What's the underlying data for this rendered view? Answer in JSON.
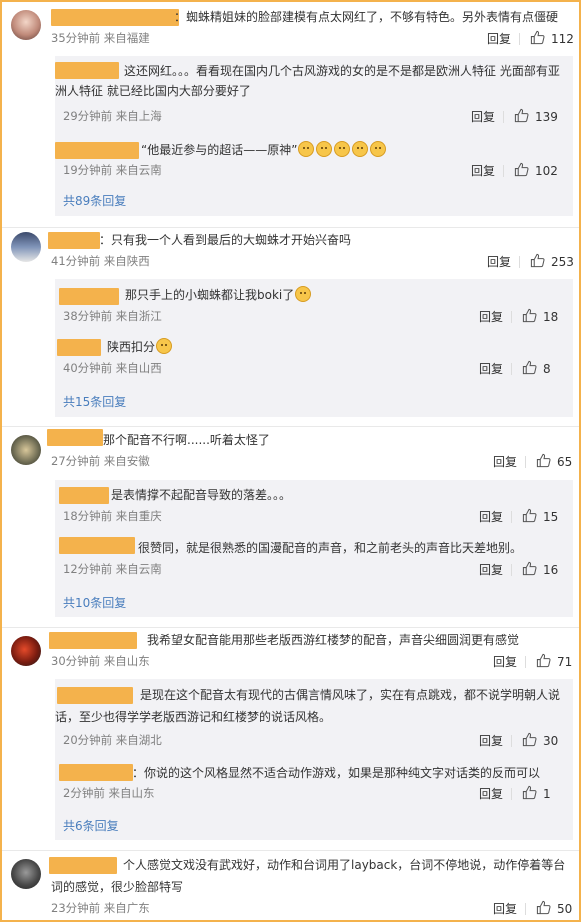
{
  "comments": [
    {
      "text": "：蜘蛛精姐妹的脸部建模有点太网红了，不够有特色。另外表情有点僵硬",
      "meta": "35分钟前 来自福建",
      "reply": "回复",
      "likes": "112",
      "replies": [
        {
          "text": "这还网红。。。看看现在国内几个古风游戏的女的是不是都是欧洲人特征 光面部有亚洲人特征 就已经比国内大部分要好了",
          "meta": "29分钟前 来自上海",
          "reply": "回复",
          "likes": "139"
        },
        {
          "text": "“他最近参与的超话——原神”",
          "meta": "19分钟前 来自云南",
          "reply": "回复",
          "likes": "102"
        }
      ],
      "more": "共89条回复"
    },
    {
      "text": "：只有我一个人看到最后的大蜘蛛才开始兴奋吗",
      "meta": "41分钟前 来自陕西",
      "reply": "回复",
      "likes": "253",
      "replies": [
        {
          "text": "那只手上的小蜘蛛都让我boki了",
          "meta": "38分钟前 来自浙江",
          "reply": "回复",
          "likes": "18"
        },
        {
          "text": "陕西扣分",
          "meta": "40分钟前 来自山西",
          "reply": "回复",
          "likes": "8"
        }
      ],
      "more": "共15条回复"
    },
    {
      "text": "那个配音不行啊......听着太怪了",
      "meta": "27分钟前 来自安徽",
      "reply": "回复",
      "likes": "65",
      "replies": [
        {
          "text": "是表情撑不起配音导致的落差。。。",
          "meta": "18分钟前 来自重庆",
          "reply": "回复",
          "likes": "15"
        },
        {
          "text": "很赞同，就是很熟悉的国漫配音的声音，和之前老头的声音比天差地别。",
          "meta": "12分钟前 来自云南",
          "reply": "回复",
          "likes": "16"
        }
      ],
      "more": "共10条回复"
    },
    {
      "text": "我希望女配音能用那些老版西游红楼梦的配音，声音尖细圆润更有感觉",
      "meta": "30分钟前 来自山东",
      "reply": "回复",
      "likes": "71",
      "replies": [
        {
          "text": "是现在这个配音太有现代的古偶言情风味了，实在有点跳戏，都不说学明朝人说话，至少也得学学老版西游记和红楼梦的说话风格。",
          "meta": "20分钟前 来自湖北",
          "reply": "回复",
          "likes": "30"
        },
        {
          "text": "：你说的这个风格显然不适合动作游戏，如果是那种纯文字对话类的反而可以",
          "meta": "2分钟前 来自山东",
          "reply": "回复",
          "likes": "1"
        }
      ],
      "more": "共6条回复"
    },
    {
      "text": "个人感觉文戏没有武戏好，动作和台词用了layback，台词不停地说，动作停着等台词的感觉，很少脸部特写",
      "meta": "23分钟前 来自广东",
      "reply": "回复",
      "likes": "50",
      "replies": []
    }
  ],
  "colors": {
    "accent": "#f4b24c",
    "link": "#4a7ebd",
    "panel": "#f2f2f5"
  },
  "icons": {
    "like": "thumb-up-icon",
    "emoji": "doge-emoji-icon"
  }
}
